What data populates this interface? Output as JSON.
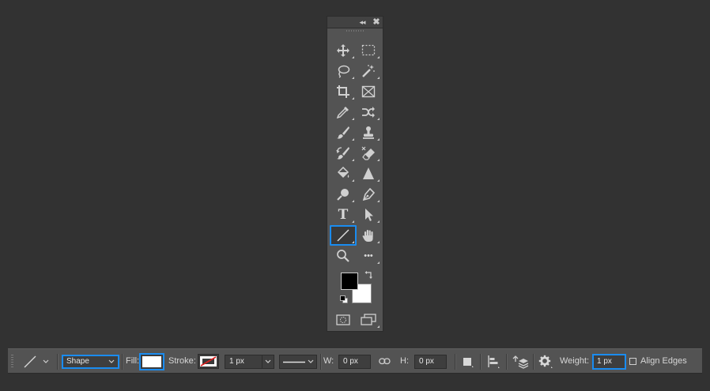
{
  "tools_panel": {
    "collapse_glyph": "◂◂",
    "close_glyph": "✖",
    "tools": [
      {
        "name": "move-tool",
        "icon": "move-icon"
      },
      {
        "name": "rectangular-marquee-tool",
        "icon": "marquee-icon"
      },
      {
        "name": "lasso-tool",
        "icon": "lasso-icon"
      },
      {
        "name": "magic-wand-tool",
        "icon": "magic-wand-icon"
      },
      {
        "name": "crop-tool",
        "icon": "crop-icon"
      },
      {
        "name": "frame-tool",
        "icon": "frame-icon"
      },
      {
        "name": "eyedropper-tool",
        "icon": "eyedropper-icon"
      },
      {
        "name": "content-aware-move-tool",
        "icon": "content-aware-move-icon"
      },
      {
        "name": "brush-tool",
        "icon": "brush-icon"
      },
      {
        "name": "clone-stamp-tool",
        "icon": "stamp-icon"
      },
      {
        "name": "history-brush-tool",
        "icon": "history-brush-icon"
      },
      {
        "name": "eraser-tool",
        "icon": "eraser-icon"
      },
      {
        "name": "paint-bucket-tool",
        "icon": "paint-bucket-icon"
      },
      {
        "name": "blur-tool",
        "icon": "blur-triangle-icon"
      },
      {
        "name": "dodge-tool",
        "icon": "dodge-icon"
      },
      {
        "name": "pen-tool",
        "icon": "pen-icon"
      },
      {
        "name": "type-tool",
        "icon": "type-icon",
        "glyph": "T"
      },
      {
        "name": "path-selection-tool",
        "icon": "arrow-icon"
      },
      {
        "name": "line-tool",
        "icon": "line-icon",
        "selected": true
      },
      {
        "name": "hand-tool",
        "icon": "hand-icon"
      },
      {
        "name": "zoom-tool",
        "icon": "zoom-icon"
      },
      {
        "name": "edit-toolbar",
        "icon": "more-icon",
        "glyph": "•••"
      }
    ],
    "foreground_color": "#000000",
    "background_color": "#ffffff",
    "bottom": [
      {
        "name": "quick-mask-button",
        "icon": "quick-mask-icon"
      },
      {
        "name": "screen-mode-button",
        "icon": "screen-mode-icon"
      }
    ]
  },
  "options_bar": {
    "tool_preset_icon": "line-icon",
    "mode_value": "Shape",
    "fill_label": "Fill:",
    "fill_color": "#ffffff",
    "stroke_label": "Stroke:",
    "stroke_width": "1 px",
    "w_label": "W:",
    "w_value": "0 px",
    "h_label": "H:",
    "h_value": "0 px",
    "weight_label": "Weight:",
    "weight_value": "1 px",
    "align_edges_label": "Align Edges",
    "align_edges_checked": false,
    "accent_color": "#1a8cf0"
  }
}
